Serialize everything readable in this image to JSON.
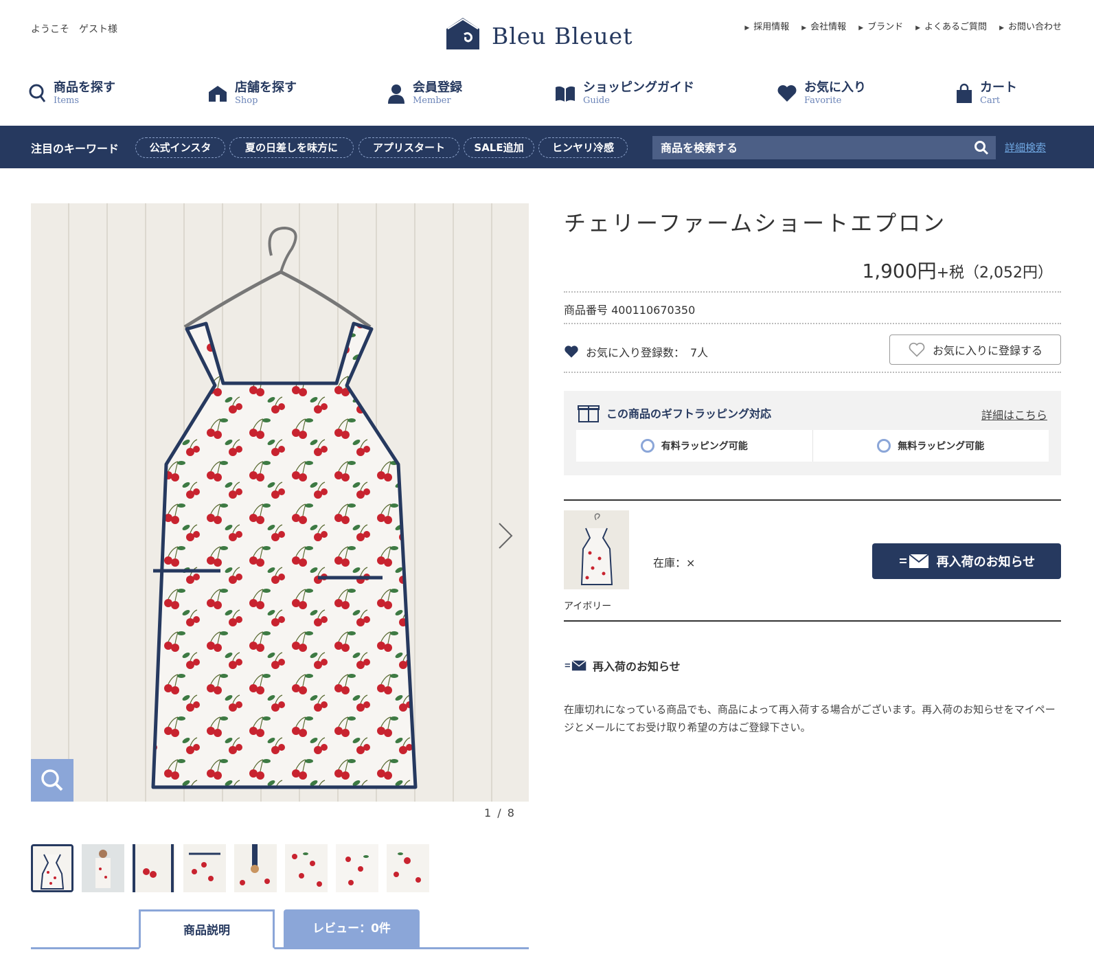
{
  "header": {
    "welcome": "ようこそ　ゲスト様",
    "logo_text": "Bleu Bleuet",
    "top_links": [
      "採用情報",
      "会社情報",
      "ブランド",
      "よくあるご質問",
      "お問い合わせ"
    ]
  },
  "nav": {
    "items": [
      {
        "jp": "商品を探す",
        "en": "Items",
        "icon": "search-icon"
      },
      {
        "jp": "店舗を探す",
        "en": "Shop",
        "icon": "shop-icon"
      },
      {
        "jp": "会員登録",
        "en": "Member",
        "icon": "member-icon"
      },
      {
        "jp": "ショッピングガイド",
        "en": "Guide",
        "icon": "book-icon"
      },
      {
        "jp": "お気に入り",
        "en": "Favorite",
        "icon": "heart-icon"
      },
      {
        "jp": "カート",
        "en": "Cart",
        "icon": "bag-icon"
      }
    ]
  },
  "keywords": {
    "label": "注目のキーワード",
    "tags": [
      "公式インスタ",
      "夏の日差しを味方に",
      "アプリスタート",
      "SALE追加",
      "ヒンヤリ冷感"
    ],
    "search_placeholder": "商品を検索する",
    "advanced_search": "詳細検索"
  },
  "gallery": {
    "counter": "1 / 8",
    "thumbnail_count": 8
  },
  "tabs": {
    "description": "商品説明",
    "review": "レビュー：0件"
  },
  "product": {
    "title": "チェリーファームショートエプロン",
    "price_main": "1,900円",
    "price_tax": "+税（2,052円）",
    "sku": "商品番号 400110670350",
    "fav_count": "お気に入り登録数：　7人",
    "fav_button": "お気に入りに登録する"
  },
  "gift": {
    "title": "この商品のギフトラッピング対応",
    "detail_link": "詳細はこちら",
    "options": [
      "有料ラッピング可能",
      "無料ラッピング可能"
    ]
  },
  "variant": {
    "color": "アイボリー",
    "stock": "在庫：×",
    "notify_button": "再入荷のお知らせ"
  },
  "restock": {
    "title": "再入荷のお知らせ",
    "text": "在庫切れになっている商品でも、商品によって再入荷する場合がございます。再入荷のお知らせをマイページとメールにてお受け取り希望の方はご登録下さい。"
  },
  "colors": {
    "navy": "#26395f",
    "accent_blue": "#8ba6d8",
    "link_blue": "#6fa6e0"
  }
}
